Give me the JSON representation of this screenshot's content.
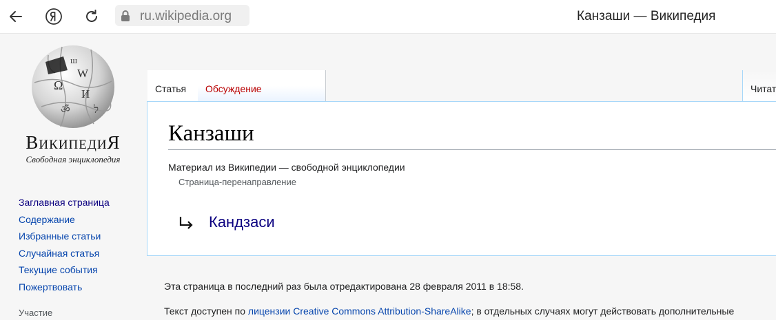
{
  "browser": {
    "url": "ru.wikipedia.org",
    "tab_title": "Канзаши — Википедия",
    "icons": [
      "back-arrow-icon",
      "yandex-icon",
      "reload-icon",
      "lock-icon"
    ]
  },
  "logo": {
    "wordmark": "ВикипедиЯ",
    "tagline": "Свободная энциклопедия"
  },
  "sidebar": {
    "items": [
      {
        "label": "Заглавная страница"
      },
      {
        "label": "Содержание"
      },
      {
        "label": "Избранные статьи"
      },
      {
        "label": "Случайная статья"
      },
      {
        "label": "Текущие события"
      },
      {
        "label": "Пожертвовать"
      }
    ],
    "section_heading": "Участие"
  },
  "tabs": {
    "article": "Статья",
    "talk": "Обсуждение",
    "read": "Читать"
  },
  "article": {
    "title": "Канзаши",
    "from_wiki": "Материал из Википедии — свободной энциклопедии",
    "redirect_label": "Страница-перенаправление",
    "redirect_target": "Кандзаси"
  },
  "footer": {
    "last_edited": "Эта страница в последний раз была отредактирована 28 февраля 2011 в 18:58.",
    "license_prefix": "Текст доступен по ",
    "license_link": "лицензии Creative Commons Attribution-ShareAlike",
    "license_suffix": "; в отдельных случаях могут действовать дополнительные"
  },
  "colors": {
    "link": "#0645ad",
    "visited_link": "#0b0080",
    "new_link": "#ba0000",
    "border": "#a7d7f9"
  }
}
